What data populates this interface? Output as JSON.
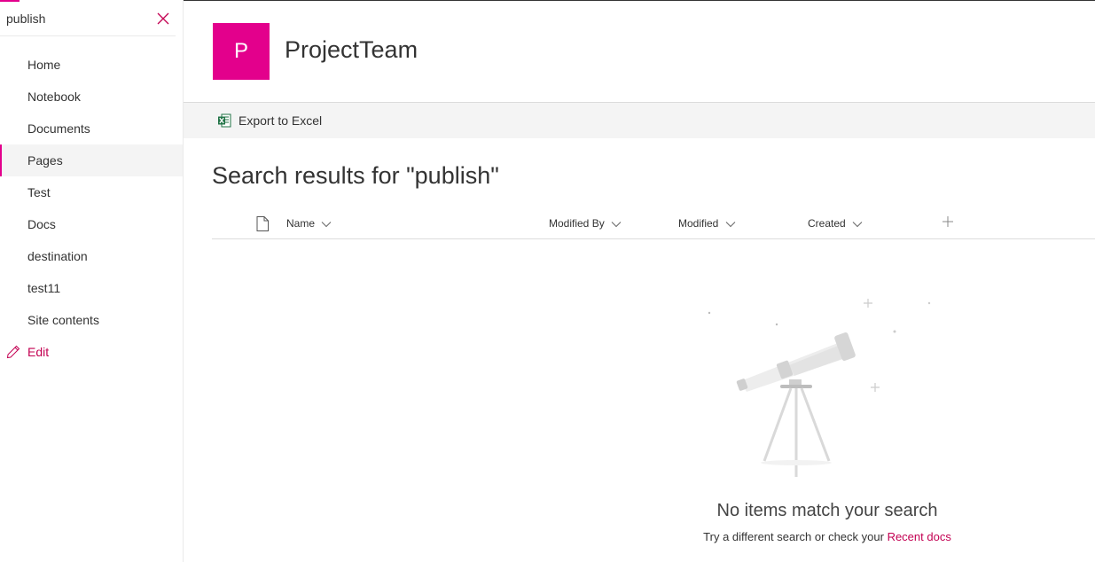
{
  "search": {
    "value": "publish"
  },
  "nav": {
    "items": [
      {
        "label": "Home"
      },
      {
        "label": "Notebook"
      },
      {
        "label": "Documents"
      },
      {
        "label": "Pages",
        "selected": true
      },
      {
        "label": "Test"
      },
      {
        "label": "Docs"
      },
      {
        "label": "destination"
      },
      {
        "label": "test11"
      },
      {
        "label": "Site contents"
      }
    ],
    "edit_label": "Edit"
  },
  "site": {
    "logo_letter": "P",
    "title": "ProjectTeam"
  },
  "commandbar": {
    "export_label": "Export to Excel"
  },
  "results": {
    "title": "Search results for \"publish\""
  },
  "columns": {
    "name": "Name",
    "modified_by": "Modified By",
    "modified": "Modified",
    "created": "Created"
  },
  "empty": {
    "title": "No items match your search",
    "subtitle": "Try a different search or check your",
    "link": "Recent docs"
  },
  "colors": {
    "accent": "#e3008c",
    "link": "#c30052",
    "commandbar_bg": "#f4f4f4"
  }
}
